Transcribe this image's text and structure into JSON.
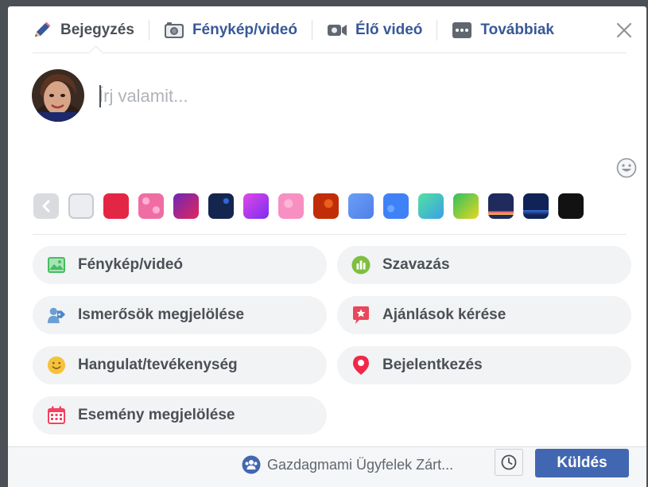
{
  "tabs": [
    {
      "label": "Bejegyzés",
      "icon": "pencil-icon",
      "active": true
    },
    {
      "label": "Fénykép/videó",
      "icon": "camera-icon",
      "active": false
    },
    {
      "label": "Élő videó",
      "icon": "video-camera-icon",
      "active": false
    },
    {
      "label": "Továbbiak",
      "icon": "more-icon",
      "active": false
    }
  ],
  "composer": {
    "placeholder": "Írj valamit..."
  },
  "swatches": [
    {
      "name": "plain",
      "color": "#ebedf0"
    },
    {
      "name": "red",
      "color": "#e42645"
    },
    {
      "name": "pink-hearts",
      "color": "#f06da3"
    },
    {
      "name": "purple-red-gradient",
      "color": "#b72aa6"
    },
    {
      "name": "dark-blue-pattern",
      "color": "#142650"
    },
    {
      "name": "purple-gradient",
      "color": "#9c31f2"
    },
    {
      "name": "pink-pattern",
      "color": "#f78fc2"
    },
    {
      "name": "red-pattern",
      "color": "#c12d07"
    },
    {
      "name": "blue-gradient",
      "color": "#5a8ef5"
    },
    {
      "name": "blue-pattern",
      "color": "#3f82f7"
    },
    {
      "name": "teal-gradient",
      "color": "#3ecbb6"
    },
    {
      "name": "green-yellow-gradient",
      "color": "#8ccc1f"
    },
    {
      "name": "night-city",
      "color": "#1e2b5c"
    },
    {
      "name": "navy-wave",
      "color": "#0f2356"
    },
    {
      "name": "black",
      "color": "#121212"
    }
  ],
  "actions": [
    {
      "label": "Fénykép/videó",
      "icon": "photo-icon"
    },
    {
      "label": "Szavazás",
      "icon": "poll-icon"
    },
    {
      "label": "Ismerősök megjelölése",
      "icon": "tag-friends-icon"
    },
    {
      "label": "Ajánlások kérése",
      "icon": "recommendation-icon"
    },
    {
      "label": "Hangulat/tevékenység",
      "icon": "smiley-icon"
    },
    {
      "label": "Bejelentkezés",
      "icon": "location-pin-icon"
    },
    {
      "label": "Esemény megjelölése",
      "icon": "calendar-icon"
    }
  ],
  "footer": {
    "audience": "Gazdagmami Ügyfelek Zárt...",
    "send_label": "Küldés"
  },
  "colors": {
    "accent": "#4267b2",
    "link": "#385898",
    "pill_bg": "#f2f3f5"
  }
}
